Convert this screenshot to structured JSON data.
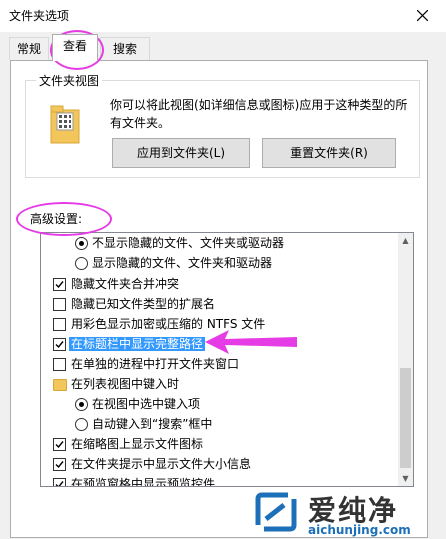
{
  "window": {
    "title": "文件夹选项"
  },
  "tabs": [
    {
      "label": "常规",
      "active": false
    },
    {
      "label": "查看",
      "active": true
    },
    {
      "label": "搜索",
      "active": false
    }
  ],
  "folder_views": {
    "legend": "文件夹视图",
    "description": "你可以将此视图(如详细信息或图标)应用于这种类型的所有文件夹。",
    "apply_button": "应用到文件夹(L)",
    "reset_button": "重置文件夹(R)"
  },
  "advanced": {
    "label": "高级设置:",
    "items": [
      {
        "type": "radio",
        "checked": true,
        "label": "不显示隐藏的文件、文件夹或驱动器"
      },
      {
        "type": "radio",
        "checked": false,
        "label": "显示隐藏的文件、文件夹和驱动器"
      },
      {
        "type": "checkbox",
        "checked": true,
        "label": "隐藏文件夹合并冲突"
      },
      {
        "type": "checkbox",
        "checked": false,
        "label": "隐藏已知文件类型的扩展名"
      },
      {
        "type": "checkbox",
        "checked": false,
        "label": "用彩色显示加密或压缩的 NTFS 文件"
      },
      {
        "type": "checkbox",
        "checked": true,
        "label": "在标题栏中显示完整路径",
        "selected": true
      },
      {
        "type": "checkbox",
        "checked": false,
        "label": "在单独的进程中打开文件夹窗口"
      },
      {
        "type": "folder",
        "label": "在列表视图中键入时"
      },
      {
        "type": "radio",
        "checked": true,
        "label": "在视图中选中键入项"
      },
      {
        "type": "radio",
        "checked": false,
        "label": "自动键入到“搜索”框中"
      },
      {
        "type": "checkbox",
        "checked": true,
        "label": "在缩略图上显示文件图标"
      },
      {
        "type": "checkbox",
        "checked": true,
        "label": "在文件夹提示中显示文件大小信息"
      },
      {
        "type": "checkbox",
        "checked": true,
        "label": "在预览窗格中显示预览控件"
      }
    ]
  },
  "annotation_color": "#e63ce6",
  "selection_color": "#3399ff",
  "watermark": {
    "brand": "爱纯净",
    "url": "aichunjing.com"
  }
}
